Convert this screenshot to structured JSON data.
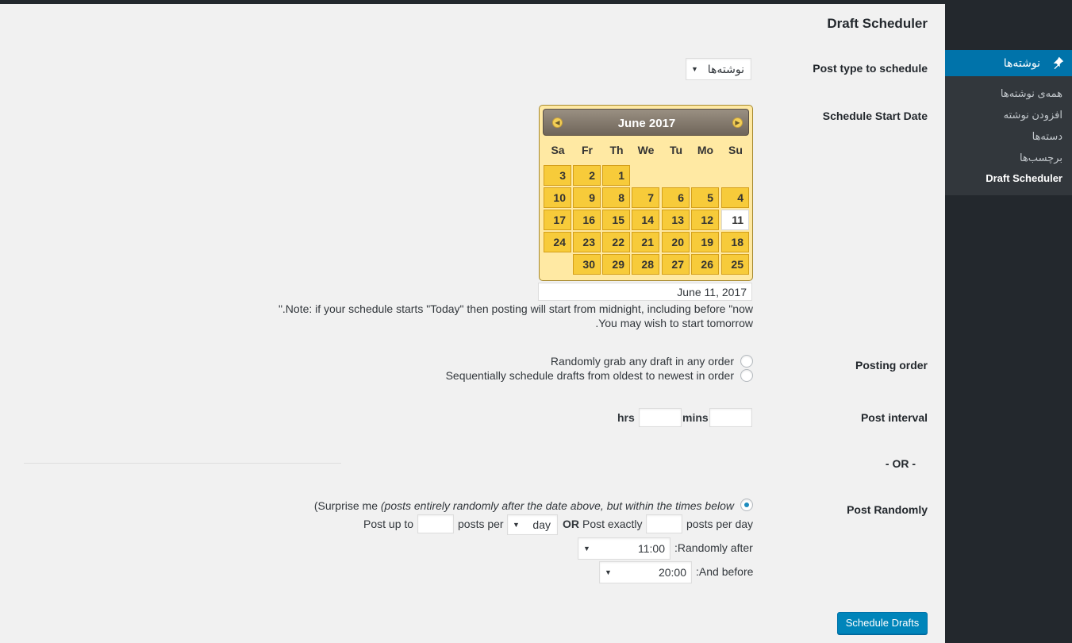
{
  "admin_menu": {
    "posts_label": "نوشته‌ها",
    "submenu": [
      {
        "label": "همه‌ی نوشته‌ها",
        "current": false
      },
      {
        "label": "افزودن نوشته",
        "current": false
      },
      {
        "label": "دسته‌ها",
        "current": false
      },
      {
        "label": "برچسب‌ها",
        "current": false
      },
      {
        "label": "Draft Scheduler",
        "current": true
      }
    ]
  },
  "page": {
    "title": "Draft Scheduler",
    "post_type": {
      "label": "Post type to schedule",
      "value": "نوشته‌ها"
    },
    "start_date": {
      "label": "Schedule Start Date",
      "calendar": {
        "month_title": "June 2017",
        "prev_icon": "chevron-left-icon",
        "next_icon": "chevron-right-icon",
        "weekdays": [
          "Sa",
          "Fr",
          "Th",
          "We",
          "Tu",
          "Mo",
          "Su"
        ],
        "weeks": [
          [
            "3",
            "2",
            "1",
            "",
            "",
            "",
            ""
          ],
          [
            "10",
            "9",
            "8",
            "7",
            "6",
            "5",
            "4"
          ],
          [
            "17",
            "16",
            "15",
            "14",
            "13",
            "12",
            "11"
          ],
          [
            "24",
            "23",
            "22",
            "21",
            "20",
            "19",
            "18"
          ],
          [
            "",
            "30",
            "29",
            "28",
            "27",
            "26",
            "25"
          ]
        ],
        "today": "11"
      },
      "value": "June 11, 2017",
      "note_line1": "\".Note: if your schedule starts \"Today\" then posting will start from midnight, including before \"now",
      "note_line2": ".You may wish to start tomorrow"
    },
    "posting_order": {
      "label": "Posting order",
      "options": [
        "Randomly grab any draft in any order",
        "Sequentially schedule drafts from oldest to newest in order"
      ]
    },
    "post_interval": {
      "label": "Post interval",
      "hrs_label": "hrs",
      "mins_label": "mins",
      "hrs_value": "",
      "mins_value": ""
    },
    "or_label": "- OR -",
    "post_randomly": {
      "label": "Post Randomly",
      "surprise_prefix": "(Surprise me ",
      "surprise_italic": "(posts entirely randomly after the date above, but within the times below",
      "post_up_to": "Post up to",
      "posts_per": "posts per",
      "period_value": "day",
      "or": "OR",
      "post_exactly": "Post exactly",
      "posts_per_day": "posts per day",
      "randomly_after_label": ":Randomly after",
      "randomly_after_value": "11:00",
      "and_before_label": ":And before",
      "and_before_value": "20:00"
    },
    "submit_label": "Schedule Drafts"
  }
}
